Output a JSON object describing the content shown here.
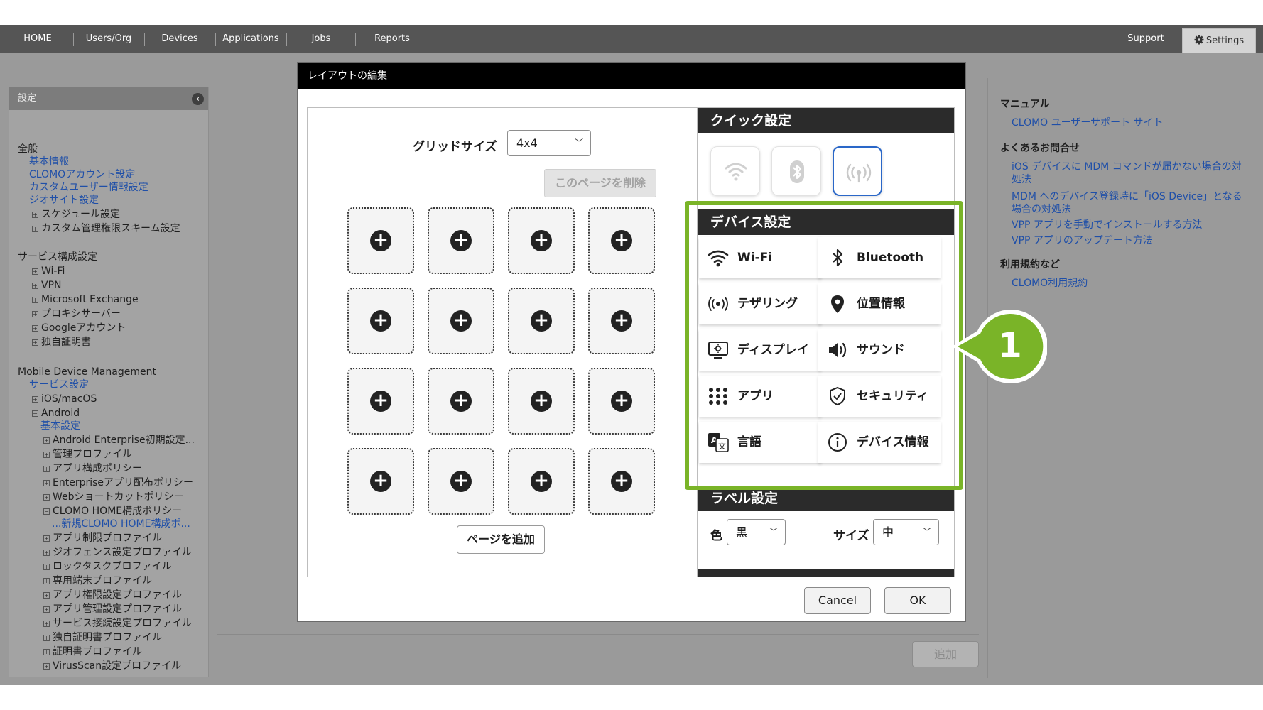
{
  "nav": {
    "items": [
      "HOME",
      "Users/Org",
      "Devices",
      "Applications",
      "Jobs",
      "Reports"
    ],
    "support": "Support",
    "settings": "Settings",
    "settings_icon": "gear-icon"
  },
  "sidebar": {
    "title": "設定",
    "lines": [
      {
        "text": "全般",
        "kind": "head"
      },
      {
        "text": "基本情報",
        "kind": "link"
      },
      {
        "text": "CLOMOアカウント設定",
        "kind": "link"
      },
      {
        "text": "カスタムユーザー情報設定",
        "kind": "link"
      },
      {
        "text": "ジオサイト設定",
        "kind": "link"
      },
      {
        "text": "スケジュール設定",
        "kind": "tree"
      },
      {
        "text": "カスタム管理権限スキーム設定",
        "kind": "tree"
      },
      {
        "text": "サービス構成設定",
        "kind": "head"
      },
      {
        "text": "Wi-Fi",
        "kind": "tree"
      },
      {
        "text": "VPN",
        "kind": "tree"
      },
      {
        "text": "Microsoft Exchange",
        "kind": "tree"
      },
      {
        "text": "プロキシサーバー",
        "kind": "tree"
      },
      {
        "text": "Googleアカウント",
        "kind": "tree"
      },
      {
        "text": "独自証明書",
        "kind": "tree"
      },
      {
        "text": "Mobile Device Management",
        "kind": "head"
      },
      {
        "text": "サービス設定",
        "kind": "link"
      },
      {
        "text": "iOS/macOS",
        "kind": "tree"
      },
      {
        "text": "Android",
        "kind": "tree-open"
      },
      {
        "text": "基本設定",
        "kind": "link2"
      },
      {
        "text": "Android Enterprise初期設定...",
        "kind": "tree2"
      },
      {
        "text": "管理プロファイル",
        "kind": "tree2"
      },
      {
        "text": "アプリ構成ポリシー",
        "kind": "tree2"
      },
      {
        "text": "Enterpriseアプリ配布ポリシー",
        "kind": "tree2"
      },
      {
        "text": "Webショートカットポリシー",
        "kind": "tree2"
      },
      {
        "text": "CLOMO HOME構成ポリシー",
        "kind": "tree2-open"
      },
      {
        "text": "...新規CLOMO HOME構成ポ...",
        "kind": "link3"
      },
      {
        "text": "アプリ制限プロファイル",
        "kind": "tree2"
      },
      {
        "text": "ジオフェンス設定プロファイル",
        "kind": "tree2"
      },
      {
        "text": "ロックタスクプロファイル",
        "kind": "tree2"
      },
      {
        "text": "専用端末プロファイル",
        "kind": "tree2"
      },
      {
        "text": "アプリ権限設定プロファイル",
        "kind": "tree2"
      },
      {
        "text": "アプリ管理設定プロファイル",
        "kind": "tree2"
      },
      {
        "text": "サービス接続設定プロファイル",
        "kind": "tree2"
      },
      {
        "text": "独自証明書プロファイル",
        "kind": "tree2"
      },
      {
        "text": "証明書プロファイル",
        "kind": "tree2"
      },
      {
        "text": "VirusScan設定プロファイル",
        "kind": "tree2"
      }
    ]
  },
  "help": {
    "lines": [
      {
        "text": "マニュアル",
        "kind": "head"
      },
      {
        "text": "CLOMO ユーザーサポート サイト",
        "kind": "link"
      },
      {
        "text": "よくあるお問合せ",
        "kind": "head"
      },
      {
        "text": "iOS デバイスに MDM コマンドが届かない場合の対",
        "kind": "link"
      },
      {
        "text": "処法",
        "kind": "link"
      },
      {
        "text": "MDM へのデバイス登録時に「iOS Device」となる",
        "kind": "link"
      },
      {
        "text": "場合の対処法",
        "kind": "link"
      },
      {
        "text": "VPP アプリを手動でインストールする方法",
        "kind": "link"
      },
      {
        "text": "VPP アプリのアップデート方法",
        "kind": "link"
      },
      {
        "text": "利用規約など",
        "kind": "head"
      },
      {
        "text": "CLOMO利用規約",
        "kind": "link"
      }
    ]
  },
  "background_add_button": "追加",
  "modal": {
    "title": "レイアウトの編集",
    "grid_label": "グリッドサイズ",
    "grid_size": "4x4",
    "delete_page": "このページを削除",
    "add_page": "ページを追加",
    "cancel": "Cancel",
    "ok": "OK",
    "quick_settings": {
      "title": "クイック設定",
      "tiles": [
        {
          "icon": "wifi-icon",
          "active": false
        },
        {
          "icon": "bluetooth-icon",
          "active": false
        },
        {
          "icon": "tethering-icon",
          "active": true
        }
      ]
    },
    "device_settings": {
      "title": "デバイス設定",
      "tiles": [
        {
          "label": "Wi-Fi",
          "icon": "wifi-icon"
        },
        {
          "label": "Bluetooth",
          "icon": "bluetooth-icon"
        },
        {
          "label": "テザリング",
          "icon": "tethering-icon"
        },
        {
          "label": "位置情報",
          "icon": "location-pin-icon"
        },
        {
          "label": "ディスプレイ",
          "icon": "display-icon"
        },
        {
          "label": "サウンド",
          "icon": "speaker-icon"
        },
        {
          "label": "アプリ",
          "icon": "apps-grid-icon"
        },
        {
          "label": "セキュリティ",
          "icon": "shield-check-icon"
        },
        {
          "label": "言語",
          "icon": "language-icon"
        },
        {
          "label": "デバイス情報",
          "icon": "info-icon"
        }
      ]
    },
    "label_settings": {
      "title": "ラベル設定",
      "color_label": "色",
      "color_value": "黒",
      "size_label": "サイズ",
      "size_value": "中"
    },
    "highlight_color": "#7ab428"
  },
  "callout": {
    "number": "1",
    "color": "#7ab428"
  }
}
